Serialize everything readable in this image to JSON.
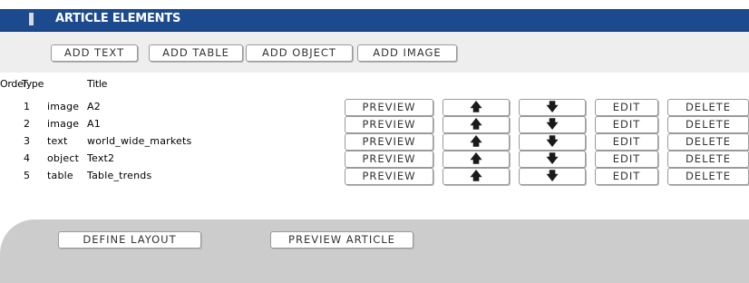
{
  "header": {
    "title": "ARTICLE ELEMENTS"
  },
  "add_buttons": {
    "add_text": "ADD TEXT",
    "add_table": "ADD TABLE",
    "add_object": "ADD OBJECT",
    "add_image": "ADD IMAGE"
  },
  "table": {
    "columns": {
      "order": "Order",
      "type": "Type",
      "title": "Title"
    },
    "rows": [
      {
        "order": "1",
        "type": "image",
        "title": "A2"
      },
      {
        "order": "2",
        "type": "image",
        "title": "A1"
      },
      {
        "order": "3",
        "type": "text",
        "title": "world_wide_markets"
      },
      {
        "order": "4",
        "type": "object",
        "title": "Text2"
      },
      {
        "order": "5",
        "type": "table",
        "title": "Table_trends"
      }
    ],
    "row_actions": {
      "preview": "PREVIEW",
      "move_up": "🡅",
      "move_down": "🡇",
      "edit": "EDIT",
      "delete": "DELETE"
    }
  },
  "footer": {
    "define_layout": "DEFINE LAYOUT",
    "preview_article": "PREVIEW ARTICLE"
  },
  "icons": {
    "move_up": "up-arrow-icon",
    "move_down": "down-arrow-icon"
  },
  "colors": {
    "header": "#1c4a8f",
    "add_bar": "#eeeeee",
    "footer_bar": "#cccccc"
  }
}
